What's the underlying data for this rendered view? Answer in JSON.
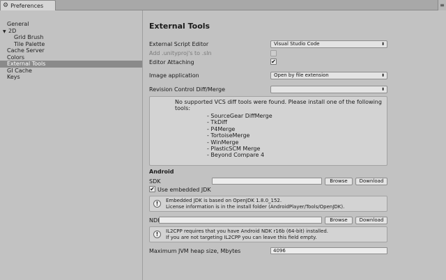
{
  "window": {
    "tab_title": "Preferences",
    "tab_icon": "gear-icon",
    "menu_icon": "window-menu-icon"
  },
  "sidebar": {
    "items": [
      {
        "label": "General",
        "level": 1,
        "selected": false
      },
      {
        "label": "2D",
        "level": 0,
        "selected": false,
        "expanded": true
      },
      {
        "label": "Grid Brush",
        "level": 2,
        "selected": false
      },
      {
        "label": "Tile Palette",
        "level": 2,
        "selected": false
      },
      {
        "label": "Cache Server",
        "level": 1,
        "selected": false
      },
      {
        "label": "Colors",
        "level": 1,
        "selected": false
      },
      {
        "label": "External Tools",
        "level": 1,
        "selected": true
      },
      {
        "label": "GI Cache",
        "level": 1,
        "selected": false
      },
      {
        "label": "Keys",
        "level": 1,
        "selected": false
      }
    ],
    "fold_glyph": "▼"
  },
  "main": {
    "title": "External Tools",
    "script_editor": {
      "label": "External Script Editor",
      "value": "Visual Studio Code"
    },
    "unityproj": {
      "label": "Add .unityproj's to .sln",
      "checked": false,
      "disabled": true
    },
    "editor_attaching": {
      "label": "Editor Attaching",
      "checked": true
    },
    "image_application": {
      "label": "Image application",
      "value": "Open by file extension"
    },
    "revision_control": {
      "label": "Revision Control Diff/Merge",
      "value": ""
    },
    "vcs_message": {
      "line1": "No supported VCS diff tools were found. Please install one of the following",
      "line2": "tools:",
      "tools": [
        "- SourceGear DiffMerge",
        "- TkDiff",
        "- P4Merge",
        "- TortoiseMerge",
        "- WinMerge",
        "- PlasticSCM Merge",
        "- Beyond Compare 4"
      ]
    },
    "android": {
      "heading": "Android",
      "sdk_label": "SDK",
      "sdk_value": "",
      "browse": "Browse",
      "download": "Download",
      "use_embedded_jdk": {
        "label": "Use embedded JDK",
        "checked": true
      },
      "jdk_info": {
        "line1": "Embedded JDK is based on OpenJDK 1.8.0_152.",
        "line2": "License information is in the install folder (AndroidPlayer/Tools/OpenJDK)."
      },
      "ndk_label": "NDK",
      "ndk_value": "",
      "ndk_info": {
        "line1": "IL2CPP requires that you have Android NDK r16b (64-bit) installed.",
        "line2": "If you are not targeting IL2CPP you can leave this field empty."
      },
      "jvm_heap": {
        "label": "Maximum JVM heap size, Mbytes",
        "value": "4096"
      }
    }
  },
  "glyphs": {
    "gear": "⚙",
    "menu": "≡",
    "arrow": "⬍",
    "check": "✔",
    "info": "!"
  },
  "colors": {
    "selection": "#8a8a8a",
    "background": "#c2c2c2"
  }
}
